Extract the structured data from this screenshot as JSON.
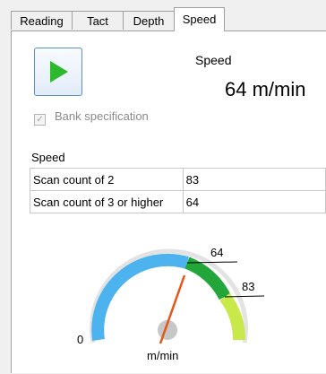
{
  "tabs": [
    {
      "label": "Reading"
    },
    {
      "label": "Tact"
    },
    {
      "label": "Depth"
    },
    {
      "label": "Speed",
      "active": true
    }
  ],
  "speed_panel": {
    "play_icon": "play-icon",
    "speed_label": "Speed",
    "speed_value": "64  m/min",
    "bank_spec": {
      "label": "Bank specification",
      "checked": true,
      "disabled": true
    }
  },
  "speed_table": {
    "caption": "Speed",
    "rows": [
      {
        "label": "Scan count of 2",
        "value": "83"
      },
      {
        "label": "Scan count of 3 or higher",
        "value": "64"
      }
    ]
  },
  "gauge": {
    "min_label": "0",
    "unit_label": "m/min",
    "markers": [
      {
        "label": "64"
      },
      {
        "label": "83"
      }
    ],
    "colors": {
      "blue": "#4db3ee",
      "green": "#22a63a",
      "yellow_green": "#c9e84a",
      "needle": "#e8561a"
    }
  }
}
